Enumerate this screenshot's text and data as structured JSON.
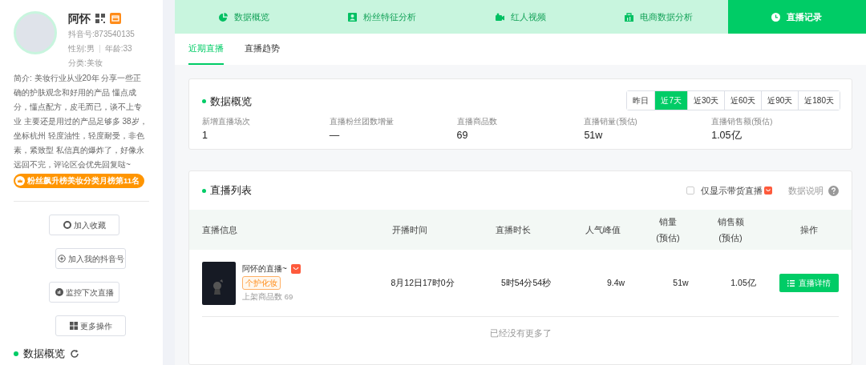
{
  "profile": {
    "name": "阿怀",
    "douyin_id": "抖音号:873540135",
    "gender": "性别:男",
    "age": "年龄:33",
    "category": "分类:美妆",
    "bio": "简介: 美妆行业从业20年 分享一些正确的护肤观念和好用的产品 懂点成分，懂点配方，皮毛而已，谈不上专业 主要还是用过的产品足够多 38岁，坐标杭州 轻度油性，轻度耐受，非色素，紧致型 私信真的爆炸了，好像永远回不完，评论区会优先回复哒~",
    "rank_badge": "粉丝飙升榜美妆分类月榜第11名"
  },
  "actions": [
    {
      "kind": "favorite",
      "label": "加入收藏"
    },
    {
      "kind": "add",
      "label": "加入我的抖音号"
    },
    {
      "kind": "monitor",
      "label": "监控下次直播"
    },
    {
      "kind": "more",
      "label": "更多操作"
    }
  ],
  "side_section": {
    "title": "数据概览"
  },
  "nav_tabs": [
    {
      "kind": "pie",
      "label": "数据概览",
      "selected": false
    },
    {
      "kind": "person",
      "label": "粉丝特征分析",
      "selected": false
    },
    {
      "kind": "video",
      "label": "红人视频",
      "selected": false
    },
    {
      "kind": "shop",
      "label": "电商数据分析",
      "selected": false
    },
    {
      "kind": "clock",
      "label": "直播记录",
      "selected": true
    }
  ],
  "sub_tabs": [
    {
      "label": "近期直播",
      "selected": true
    },
    {
      "label": "直播趋势",
      "selected": false
    }
  ],
  "overview": {
    "title": "数据概览",
    "ranges": [
      {
        "label": "昨日",
        "selected": false
      },
      {
        "label": "近7天",
        "selected": true
      },
      {
        "label": "近30天",
        "selected": false
      },
      {
        "label": "近60天",
        "selected": false
      },
      {
        "label": "近90天",
        "selected": false
      },
      {
        "label": "近180天",
        "selected": false
      }
    ],
    "stats": [
      {
        "label": "新增直播场次",
        "value": "1"
      },
      {
        "label": "直播粉丝团数增量",
        "value": "—"
      },
      {
        "label": "直播商品数",
        "value": "69"
      },
      {
        "label": "直播销量(预估)",
        "value": "51w"
      },
      {
        "label": "直播销售额(预估)",
        "value": "1.05亿"
      }
    ]
  },
  "live_list": {
    "title": "直播列表",
    "filter": {
      "label": "仅显示带货直播",
      "checked": false
    },
    "help": "数据说明",
    "columns": [
      {
        "lines": [
          "直播信息"
        ]
      },
      {
        "lines": [
          "开播时间"
        ]
      },
      {
        "lines": [
          "直播时长"
        ]
      },
      {
        "lines": [
          "人气峰值"
        ]
      },
      {
        "lines": [
          "销量",
          "(预估)"
        ]
      },
      {
        "lines": [
          "销售额",
          "(预估)"
        ]
      },
      {
        "lines": [
          "操作"
        ]
      }
    ],
    "rows": [
      {
        "title": "阿怀的直播~",
        "tag": "个护化妆",
        "products": "上架商品数 69",
        "start": "8月12日17时0分",
        "duration": "5时54分54秒",
        "peak": "9.4w",
        "sales": "51w",
        "revenue": "1.05亿",
        "action": "直播详情"
      }
    ],
    "footer": "已经没有更多了"
  }
}
